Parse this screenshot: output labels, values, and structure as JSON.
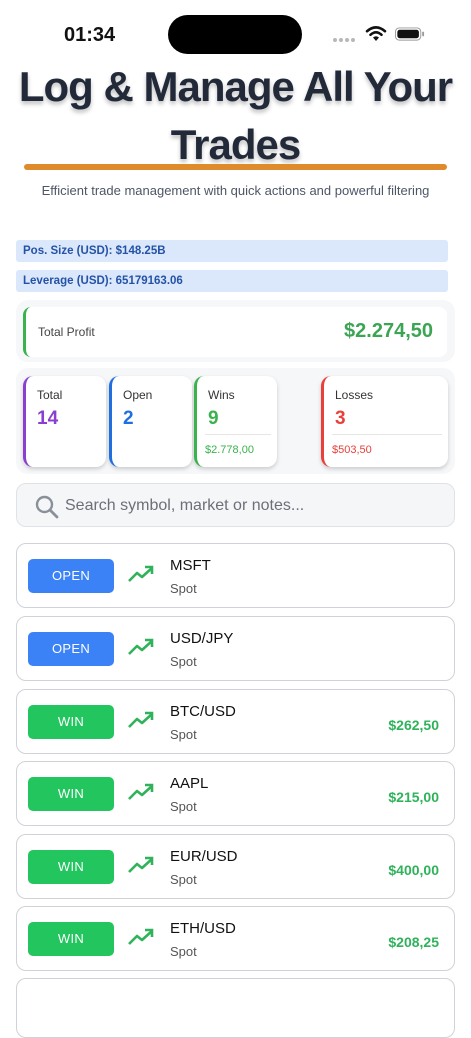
{
  "status_bar": {
    "time": "01:34"
  },
  "header": {
    "title": "Log & Manage All Your Trades",
    "subtitle": "Efficient trade management with quick actions and powerful filtering"
  },
  "info": {
    "pos_size": "Pos. Size (USD): $148.25B",
    "leverage": "Leverage (USD): 65179163.06"
  },
  "profit": {
    "label": "Total Profit",
    "value": "$2.274,50",
    "color": "#3ba553"
  },
  "stats": [
    {
      "label": "Total",
      "value": "14",
      "sub": "",
      "color": "#8a3fd1"
    },
    {
      "label": "Open",
      "value": "2",
      "sub": "",
      "color": "#1f6fe0"
    },
    {
      "label": "Wins",
      "value": "9",
      "sub": "$2.778,00",
      "color": "#3ab24d"
    },
    {
      "label": "Losses",
      "value": "3",
      "sub": "$503,50",
      "color": "#e8403a"
    }
  ],
  "search": {
    "placeholder": "Search symbol, market or notes..."
  },
  "colors": {
    "open": "#3b82f6",
    "win": "#22c55e",
    "amount": "#2fb25a",
    "accent": "#df8b2c"
  },
  "trades": [
    {
      "status": "OPEN",
      "symbol": "MSFT",
      "market": "Spot",
      "amount": ""
    },
    {
      "status": "OPEN",
      "symbol": "USD/JPY",
      "market": "Spot",
      "amount": ""
    },
    {
      "status": "WIN",
      "symbol": "BTC/USD",
      "market": "Spot",
      "amount": "$262,50"
    },
    {
      "status": "WIN",
      "symbol": "AAPL",
      "market": "Spot",
      "amount": "$215,00"
    },
    {
      "status": "WIN",
      "symbol": "EUR/USD",
      "market": "Spot",
      "amount": "$400,00"
    },
    {
      "status": "WIN",
      "symbol": "ETH/USD",
      "market": "Spot",
      "amount": "$208,25"
    }
  ]
}
